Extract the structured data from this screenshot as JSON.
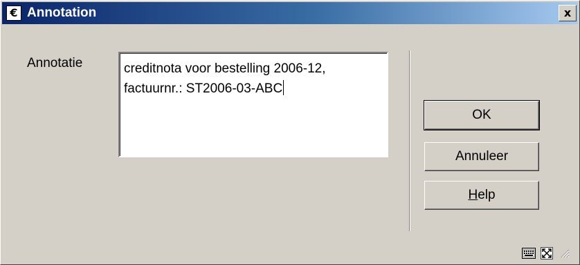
{
  "window": {
    "title": "Annotation",
    "app_icon_glyph": "€",
    "close_glyph": "x"
  },
  "form": {
    "label": "Annotatie",
    "value": "creditnota voor bestelling 2006-12,\nfactuurnr.: ST2006-03-ABC"
  },
  "buttons": {
    "ok": "OK",
    "cancel": "Annuleer",
    "help_mnemonic": "H",
    "help_rest": "elp"
  },
  "icons": {
    "app": "euro-icon",
    "close": "close-icon",
    "keyboard": "keyboard-icon",
    "maximize": "maximize-icon",
    "resize": "resize-grip-icon"
  },
  "colors": {
    "titlebar_start": "#0a246a",
    "titlebar_end": "#a6caf0",
    "dialog_bg": "#d4d0c8"
  }
}
